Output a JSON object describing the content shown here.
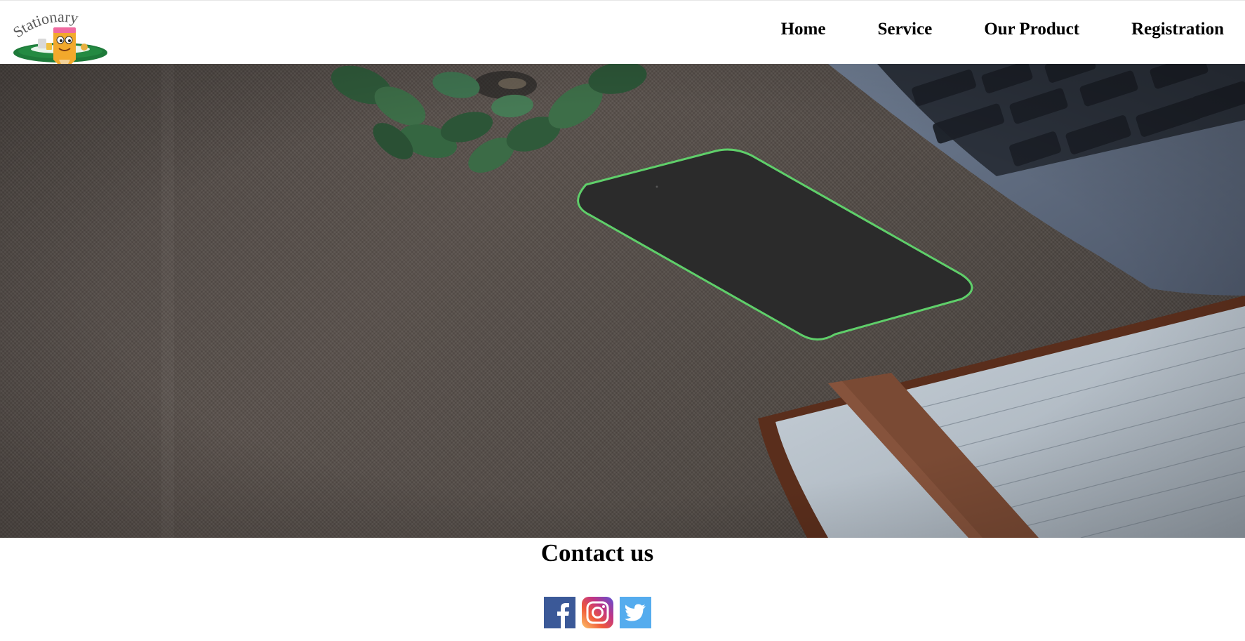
{
  "header": {
    "logo": {
      "text": "Stationary",
      "icon": "pencil-mascot-logo"
    },
    "nav": [
      {
        "label": "Home"
      },
      {
        "label": "Service"
      },
      {
        "label": "Our Product"
      },
      {
        "label": "Registration"
      }
    ]
  },
  "hero": {
    "image": "desk-scene-phone-laptop-plant-notebook"
  },
  "contact": {
    "title": "Contact us",
    "social": [
      {
        "icon": "facebook-icon",
        "color": "#3b5998"
      },
      {
        "icon": "instagram-icon",
        "color": "#c13584"
      },
      {
        "icon": "twitter-icon",
        "color": "#55acee"
      }
    ]
  },
  "colors": {
    "background": "#ffffff",
    "text": "#000000",
    "logo_green": "#1e7a3a",
    "phone_accent": "#5fcf6a"
  }
}
